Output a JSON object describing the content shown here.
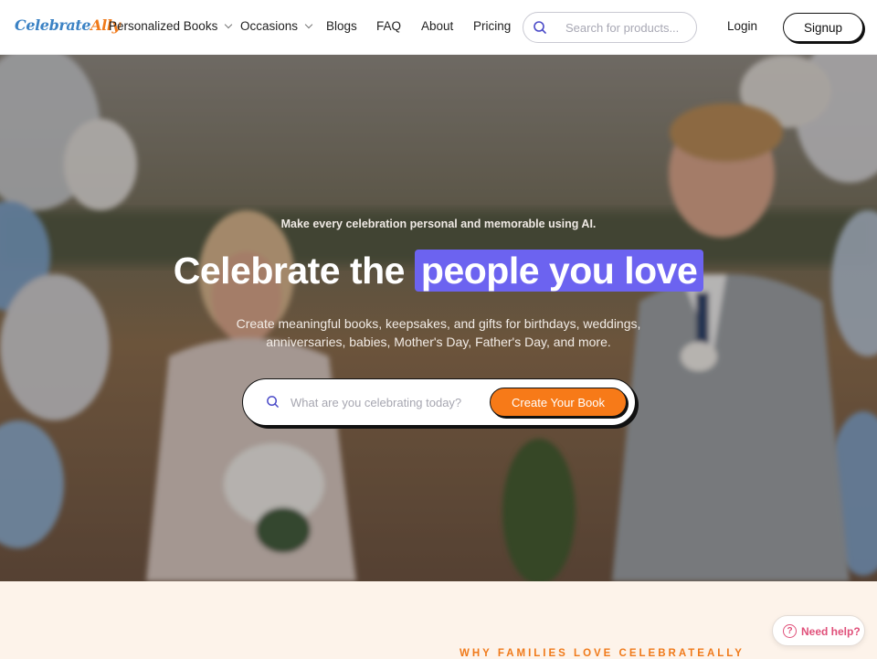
{
  "nav": {
    "logo_part1": "Celebrate",
    "logo_part2": "Ally",
    "links": [
      {
        "label": "Personalized Books",
        "has_dropdown": true
      },
      {
        "label": "Occasions",
        "has_dropdown": true
      },
      {
        "label": "Blogs",
        "has_dropdown": false
      },
      {
        "label": "FAQ",
        "has_dropdown": false
      },
      {
        "label": "About",
        "has_dropdown": false
      },
      {
        "label": "Pricing",
        "has_dropdown": false
      }
    ],
    "search_placeholder": "Search for products...",
    "login_label": "Login",
    "signup_label": "Signup"
  },
  "hero": {
    "eyebrow": "Make every celebration personal and memorable using AI.",
    "headline_plain": "Celebrate the",
    "headline_highlight": "people you love",
    "subtext": "Create meaningful books, keepsakes, and gifts for birthdays, weddings, anniversaries, babies, Mother's Day, Father's Day, and more.",
    "cta_placeholder": "What are you celebrating today?",
    "cta_button": "Create Your Book"
  },
  "section": {
    "eyebrow": "WHY FAMILIES LOVE CELEBRATEALLY"
  },
  "help_widget": {
    "label": "Need help?"
  },
  "colors": {
    "accent_orange": "#f77a18",
    "highlight_purple": "#6c63f0",
    "logo_blue": "#3b82c4",
    "help_pink": "#e0507a",
    "section_bg": "#fdf3ea"
  },
  "icons": [
    "search-icon",
    "chevron-down-icon",
    "help-question-icon"
  ]
}
